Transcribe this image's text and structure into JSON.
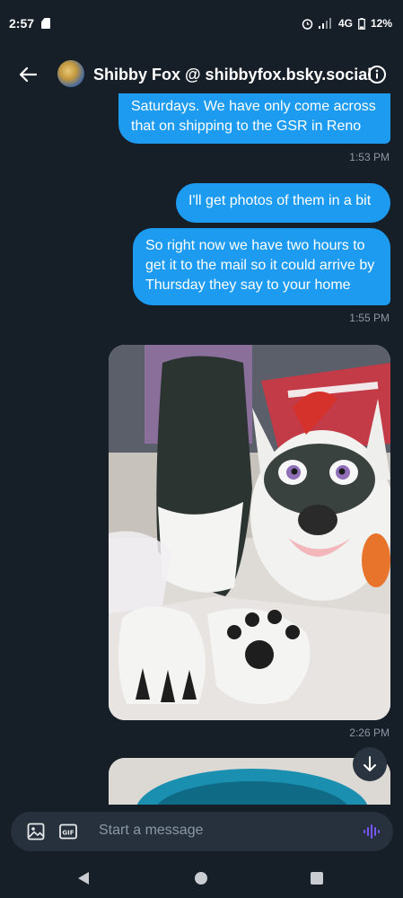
{
  "status_bar": {
    "time": "2:57",
    "network": "4G",
    "battery": "12%"
  },
  "header": {
    "title": "Shibby Fox @ shibbyfox.bsky.social"
  },
  "messages": [
    {
      "text": "Saturdays. We have only come across that on shipping to the GSR in Reno",
      "time": "1:53 PM"
    },
    {
      "text": "I'll get photos of them in a bit"
    },
    {
      "text": "So right now we have two hours to get it to the mail so it could arrive by Thursday they say to your home",
      "time": "1:55 PM"
    },
    {
      "image": "fursuit-head-and-paws-photo",
      "time": "2:26 PM"
    }
  ],
  "composer": {
    "placeholder": "Start a message",
    "gif_label": "GIF"
  },
  "colors": {
    "background": "#161e27",
    "bubble": "#1d9bf0",
    "composer": "#26313d",
    "timestamp": "#8b98a5",
    "voice": "#7856ff"
  }
}
